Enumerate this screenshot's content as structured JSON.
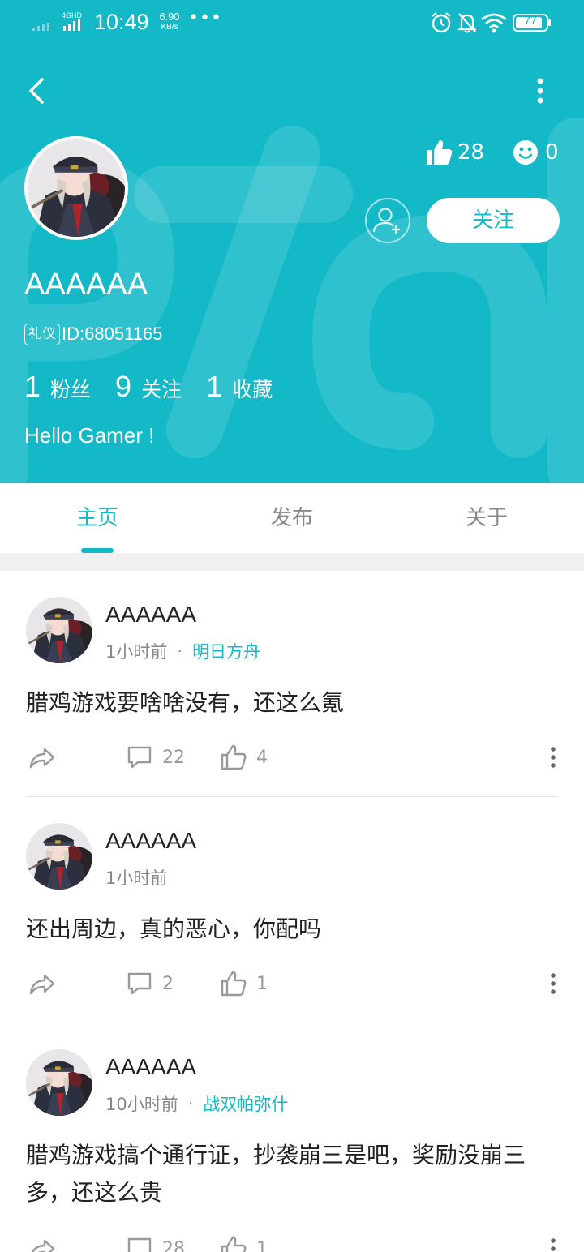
{
  "status_bar": {
    "network": "4GHD",
    "time": "10:49",
    "speed_value": "6.90",
    "speed_unit": "KB/s",
    "overflow": "•••",
    "battery": "77"
  },
  "colors": {
    "accent": "#14b9c8",
    "text": "#222222",
    "muted": "#888888"
  },
  "profile": {
    "likes": "28",
    "emotes": "0",
    "follow_label": "关注",
    "username": "AAAAAA",
    "tag": "礼仪",
    "id_text": "ID:68051165",
    "stats": [
      {
        "num": "1",
        "label": "粉丝"
      },
      {
        "num": "9",
        "label": "关注"
      },
      {
        "num": "1",
        "label": "收藏"
      }
    ],
    "bio": "Hello Gamer !"
  },
  "tabs": [
    {
      "label": "主页",
      "active": true
    },
    {
      "label": "发布",
      "active": false
    },
    {
      "label": "关于",
      "active": false
    }
  ],
  "posts": [
    {
      "author": "AAAAAA",
      "time": "1小时前",
      "dot": "·",
      "game": "明日方舟",
      "text": "腊鸡游戏要啥啥没有，还这么氪",
      "comments": "22",
      "likes": "4"
    },
    {
      "author": "AAAAAA",
      "time": "1小时前",
      "dot": "",
      "game": "",
      "text": "还出周边，真的恶心，你配吗",
      "comments": "2",
      "likes": "1"
    },
    {
      "author": "AAAAAA",
      "time": "10小时前",
      "dot": "·",
      "game": "战双帕弥什",
      "text": "腊鸡游戏搞个通行证，抄袭崩三是吧，奖励没崩三多，还这么贵",
      "comments": "28",
      "likes": "1"
    }
  ]
}
